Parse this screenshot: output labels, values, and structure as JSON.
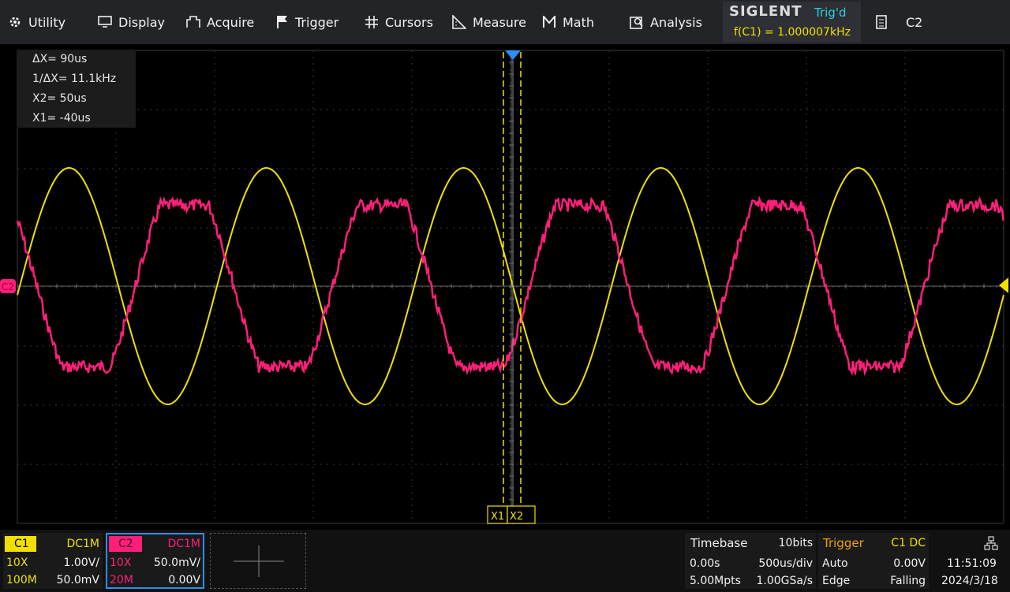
{
  "menu": {
    "utility": "Utility",
    "display": "Display",
    "acquire": "Acquire",
    "trigger": "Trigger",
    "cursors": "Cursors",
    "measure": "Measure",
    "math": "Math",
    "analysis": "Analysis"
  },
  "brand": {
    "logo": "SIGLENT",
    "trig_state": "Trig'd",
    "frequency": "f(C1) = 1.000007kHz"
  },
  "channel_select": "C2",
  "cursor_readout": {
    "delta_x": "ΔX= 90us",
    "inv_delta_x": "1/ΔX= 11.1kHz",
    "x2": "X2= 50us",
    "x1": "X1= -40us"
  },
  "cursor_labels": {
    "x1": "X1",
    "x2": "X2"
  },
  "c2_marker": "C2",
  "c1": {
    "label": "C1",
    "coupling": "DC1M",
    "probe": "10X",
    "scale": "1.00V/",
    "bw": "100M",
    "offset": "50.0mV"
  },
  "c2": {
    "label": "C2",
    "coupling": "DC1M",
    "probe": "10X",
    "scale": "50.0mV/",
    "bw": "20M",
    "offset": "0.00V"
  },
  "timebase": {
    "title": "Timebase",
    "bits": "10bits",
    "delay": "0.00s",
    "scale": "500us/div",
    "memory": "5.00Mpts",
    "rate": "1.00GSa/s"
  },
  "trigger": {
    "title": "Trigger",
    "source": "C1 DC",
    "mode": "Auto",
    "level": "0.00V",
    "type": "Edge",
    "slope": "Falling"
  },
  "clock": {
    "time": "11:51:09",
    "date": "2024/3/18"
  },
  "colors": {
    "c1": "#f0e000",
    "c2": "#ff1f7a",
    "accent": "#2ad0e0"
  }
}
